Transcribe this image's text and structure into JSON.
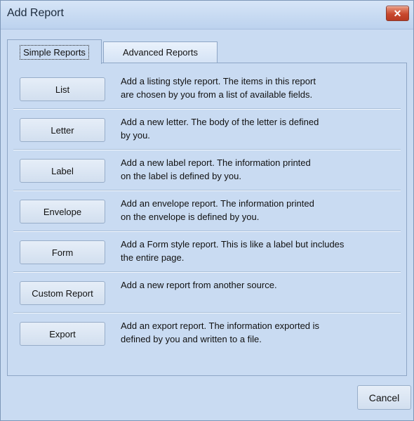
{
  "window": {
    "title": "Add Report",
    "close_label": "✕"
  },
  "tabs": [
    {
      "label": "Simple Reports",
      "active": true
    },
    {
      "label": "Advanced  Reports",
      "active": false
    }
  ],
  "reports": [
    {
      "button": "List",
      "line1": "Add a listing style report.  The items in this report",
      "line2": "are chosen by you from a list of available fields."
    },
    {
      "button": "Letter",
      "line1": "Add a new letter.  The body of the letter is defined",
      "line2": "by you."
    },
    {
      "button": "Label",
      "line1": "Add a new label report.  The information printed",
      "line2": "on the label is defined by you."
    },
    {
      "button": "Envelope",
      "line1": "Add an envelope report.  The information printed",
      "line2": "on the envelope is defined by you."
    },
    {
      "button": "Form",
      "line1": "Add a Form style report.  This is like a label but includes",
      "line2": "the entire page."
    },
    {
      "button": "Custom Report",
      "line1": "Add a new report from another source.",
      "line2": ""
    },
    {
      "button": "Export",
      "line1": "Add an export report.  The information exported is",
      "line2": "defined by you and written to a file."
    }
  ],
  "footer": {
    "cancel_label": "Cancel"
  }
}
